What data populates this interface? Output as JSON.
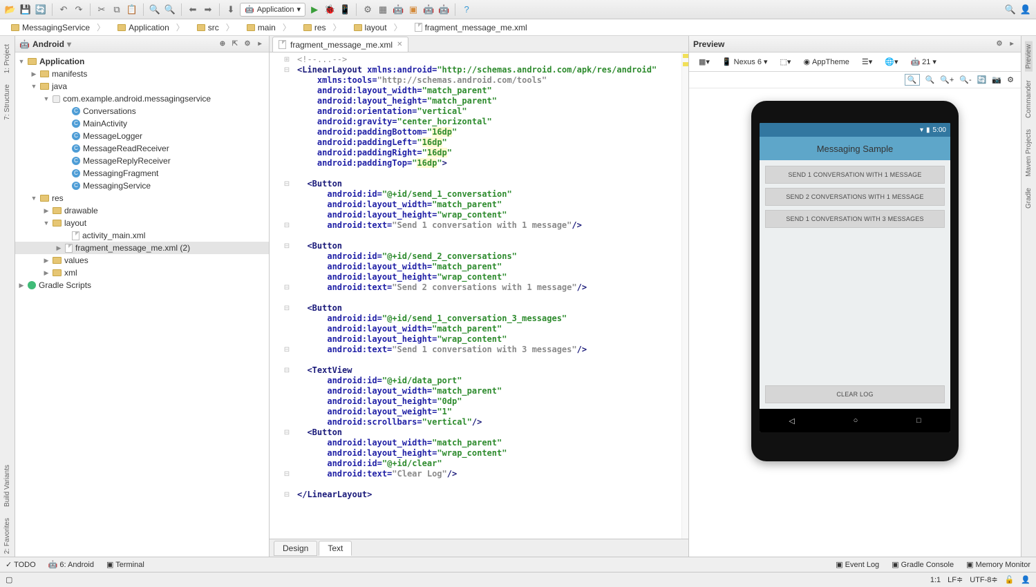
{
  "toolbar": {
    "app_selector": "Application"
  },
  "breadcrumb": [
    "MessagingService",
    "Application",
    "src",
    "main",
    "res",
    "layout",
    "fragment_message_me.xml"
  ],
  "project": {
    "view_name": "Android",
    "root": "Application",
    "manifests": "manifests",
    "java": "java",
    "package": "com.example.android.messagingservice",
    "classes": [
      "Conversations",
      "MainActivity",
      "MessageLogger",
      "MessageReadReceiver",
      "MessageReplyReceiver",
      "MessagingFragment",
      "MessagingService"
    ],
    "res": "res",
    "drawable": "drawable",
    "layout": "layout",
    "layout_files": [
      "activity_main.xml",
      "fragment_message_me.xml (2)"
    ],
    "values": "values",
    "xml": "xml",
    "gradle": "Gradle Scripts"
  },
  "editor": {
    "tab": "fragment_message_me.xml",
    "code_lines": [
      {
        "gut": "⊕",
        "fold": "⊞",
        "html": "<span class='cm'>&lt;!--...--&gt;</span>"
      },
      {
        "gut": "ⓒ",
        "fold": "⊟",
        "html": "<span class='kw'>&lt;LinearLayout</span> <span class='attr'>xmlns:android=</span><span class='val'>\"http://schemas.android.com/apk/res/android\"</span>"
      },
      {
        "gut": "",
        "fold": "",
        "html": "    <span class='attr'>xmlns:tools=</span><span class='str'>\"http://schemas.android.com/tools\"</span>"
      },
      {
        "gut": "",
        "fold": "",
        "html": "    <span class='attr'>android:layout_width=</span><span class='val'>\"match_parent\"</span>"
      },
      {
        "gut": "",
        "fold": "",
        "html": "    <span class='attr'>android:layout_height=</span><span class='val'>\"match_parent\"</span>"
      },
      {
        "gut": "",
        "fold": "",
        "html": "    <span class='attr'>android:orientation=</span><span class='val'>\"vertical\"</span>"
      },
      {
        "gut": "",
        "fold": "",
        "html": "    <span class='attr'>android:gravity=</span><span class='val'>\"center_horizontal\"</span>"
      },
      {
        "gut": "",
        "fold": "",
        "html": "    <span class='attr'>android:paddingBottom=</span><span class='val'>\"<span class='hl-y'>16dp</span>\"</span>"
      },
      {
        "gut": "",
        "fold": "",
        "html": "    <span class='attr'>android:paddingLeft=</span><span class='val'>\"<span class='hl-y'>16dp</span>\"</span>"
      },
      {
        "gut": "",
        "fold": "",
        "html": "    <span class='attr'>android:paddingRight=</span><span class='val'>\"<span class='hl-y'>16dp</span>\"</span>"
      },
      {
        "gut": "",
        "fold": "",
        "html": "    <span class='attr'>android:paddingTop=</span><span class='val'>\"<span class='hl-y'>16dp</span>\"</span><span class='kw'>&gt;</span>"
      },
      {
        "gut": "",
        "fold": "",
        "html": ""
      },
      {
        "gut": "",
        "fold": "⊟",
        "html": "  <span class='kw'>&lt;Button</span>"
      },
      {
        "gut": "",
        "fold": "",
        "html": "      <span class='attr'>android:id=</span><span class='val'>\"@+id/send_1_conversation\"</span>"
      },
      {
        "gut": "",
        "fold": "",
        "html": "      <span class='attr'>android:layout_width=</span><span class='val'>\"match_parent\"</span>"
      },
      {
        "gut": "",
        "fold": "",
        "html": "      <span class='attr'>android:layout_height=</span><span class='val'>\"wrap_content\"</span>"
      },
      {
        "gut": "",
        "fold": "⊟",
        "html": "      <span class='attr'>android:text=</span><span class='str'>\"Send 1 conversation with 1 message\"</span><span class='kw'>/&gt;</span>"
      },
      {
        "gut": "",
        "fold": "",
        "html": ""
      },
      {
        "gut": "",
        "fold": "⊟",
        "html": "  <span class='kw'>&lt;Button</span>"
      },
      {
        "gut": "",
        "fold": "",
        "html": "      <span class='attr'>android:id=</span><span class='val'>\"@+id/send_2_conversations\"</span>"
      },
      {
        "gut": "",
        "fold": "",
        "html": "      <span class='attr'>android:layout_width=</span><span class='val'>\"match_parent\"</span>"
      },
      {
        "gut": "",
        "fold": "",
        "html": "      <span class='attr'>android:layout_height=</span><span class='val'>\"wrap_content\"</span>"
      },
      {
        "gut": "",
        "fold": "⊟",
        "html": "      <span class='attr'>android:text=</span><span class='str'>\"Send 2 conversations with 1 message\"</span><span class='kw'>/&gt;</span>"
      },
      {
        "gut": "",
        "fold": "",
        "html": ""
      },
      {
        "gut": "",
        "fold": "⊟",
        "html": "  <span class='kw'>&lt;Button</span>"
      },
      {
        "gut": "",
        "fold": "",
        "html": "      <span class='attr'>android:id=</span><span class='val'>\"@+id/send_1_conversation_3_messages\"</span>"
      },
      {
        "gut": "",
        "fold": "",
        "html": "      <span class='attr'>android:layout_width=</span><span class='val'>\"match_parent\"</span>"
      },
      {
        "gut": "",
        "fold": "",
        "html": "      <span class='attr'>android:layout_height=</span><span class='val'>\"wrap_content\"</span>"
      },
      {
        "gut": "",
        "fold": "⊟",
        "html": "      <span class='attr'>android:text=</span><span class='str'>\"Send 1 conversation with 3 messages\"</span><span class='kw'>/&gt;</span>"
      },
      {
        "gut": "",
        "fold": "",
        "html": ""
      },
      {
        "gut": "",
        "fold": "⊟",
        "html": "  <span class='kw'>&lt;TextView</span>"
      },
      {
        "gut": "",
        "fold": "",
        "html": "      <span class='attr'>android:id=</span><span class='val'>\"@+id/data_port\"</span>"
      },
      {
        "gut": "",
        "fold": "",
        "html": "      <span class='attr'>android:layout_width=</span><span class='val'>\"match_parent\"</span>"
      },
      {
        "gut": "",
        "fold": "",
        "html": "      <span class='attr'>android:layout_height=</span><span class='val'>\"0dp\"</span>"
      },
      {
        "gut": "",
        "fold": "",
        "html": "      <span class='attr'>android:layout_weight=</span><span class='val'>\"1\"</span>"
      },
      {
        "gut": "",
        "fold": "",
        "html": "      <span class='attr'>android:scrollbars=</span><span class='val'>\"vertical\"</span><span class='kw'>/&gt;</span>"
      },
      {
        "gut": "",
        "fold": "⊟",
        "html": "  <span class='kw'>&lt;Button</span>"
      },
      {
        "gut": "",
        "fold": "",
        "html": "      <span class='attr'>android:layout_width=</span><span class='val'>\"match_parent\"</span>"
      },
      {
        "gut": "",
        "fold": "",
        "html": "      <span class='attr'>android:layout_height=</span><span class='val'>\"wrap_content\"</span>"
      },
      {
        "gut": "",
        "fold": "",
        "html": "      <span class='attr'>android:id=</span><span class='val'>\"@+id/clear\"</span>"
      },
      {
        "gut": "",
        "fold": "⊟",
        "html": "      <span class='attr'>android:text=</span><span class='str'>\"Clear Log\"</span><span class='kw'>/&gt;</span>"
      },
      {
        "gut": "",
        "fold": "",
        "html": ""
      },
      {
        "gut": "",
        "fold": "⊟",
        "html": "<span class='kw'>&lt;/LinearLayout&gt;</span>"
      }
    ],
    "footer_tabs": [
      "Design",
      "Text"
    ]
  },
  "preview": {
    "title": "Preview",
    "device": "Nexus 6",
    "theme": "AppTheme",
    "api": "21",
    "statusbar_time": "5:00",
    "app_title": "Messaging Sample",
    "buttons": [
      "SEND 1 CONVERSATION WITH 1 MESSAGE",
      "SEND 2 CONVERSATIONS WITH 1 MESSAGE",
      "SEND 1 CONVERSATION WITH 3 MESSAGES"
    ],
    "clear_button": "CLEAR LOG"
  },
  "side_left": [
    "1: Project",
    "7: Structure"
  ],
  "side_left_bottom": [
    "Build Variants",
    "2: Favorites"
  ],
  "side_right": [
    "Preview",
    "Commander",
    "Maven Projects",
    "Gradle"
  ],
  "bottom_tools": [
    "TODO",
    "6: Android",
    "Terminal"
  ],
  "bottom_right": [
    "Event Log",
    "Gradle Console",
    "Memory Monitor"
  ],
  "status": {
    "pos": "1:1",
    "line_end": "LF",
    "encoding": "UTF-8"
  }
}
